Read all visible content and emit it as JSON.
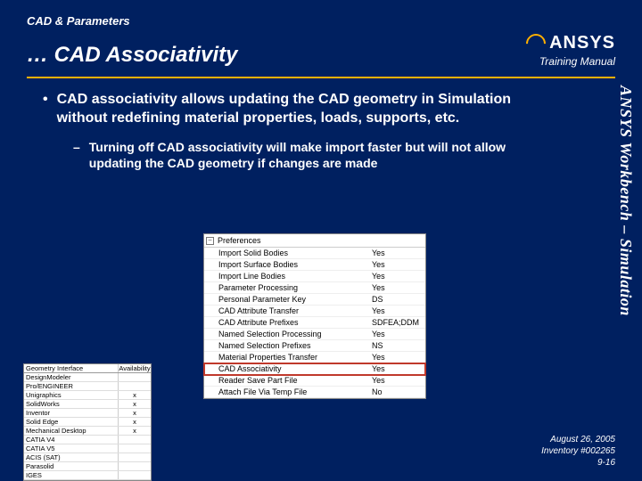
{
  "header": {
    "section_label": "CAD & Parameters",
    "title": "… CAD Associativity",
    "logo_text": "ANSYS",
    "training_manual": "Training Manual"
  },
  "sidebar_text": "ANSYS Workbench – Simulation",
  "bullets": {
    "main": "CAD associativity allows updating the CAD geometry in Simulation without redefining material properties, loads, supports, etc.",
    "sub": "Turning off CAD associativity will make import faster but will not allow updating the CAD geometry if changes are made"
  },
  "preferences": {
    "heading": "Preferences",
    "rows": [
      {
        "k": "Import Solid Bodies",
        "v": "Yes"
      },
      {
        "k": "Import Surface Bodies",
        "v": "Yes"
      },
      {
        "k": "Import Line Bodies",
        "v": "Yes"
      },
      {
        "k": "Parameter Processing",
        "v": "Yes"
      },
      {
        "k": "Personal Parameter Key",
        "v": "DS"
      },
      {
        "k": "CAD Attribute Transfer",
        "v": "Yes"
      },
      {
        "k": "CAD Attribute Prefixes",
        "v": "SDFEA;DDM"
      },
      {
        "k": "Named Selection Processing",
        "v": "Yes"
      },
      {
        "k": "Named Selection Prefixes",
        "v": "NS"
      },
      {
        "k": "Material Properties Transfer",
        "v": "Yes"
      },
      {
        "k": "CAD Associativity",
        "v": "Yes",
        "hl": true
      },
      {
        "k": "Reader Save Part File",
        "v": "Yes"
      },
      {
        "k": "Attach File Via Temp File",
        "v": "No"
      }
    ]
  },
  "availability": {
    "head": {
      "c1": "Geometry Interface",
      "c2": "Availability"
    },
    "rows": [
      {
        "c1": "DesignModeler",
        "c2": ""
      },
      {
        "c1": "Pro/ENGINEER",
        "c2": ""
      },
      {
        "c1": "Unigraphics",
        "c2": "x"
      },
      {
        "c1": "SolidWorks",
        "c2": "x"
      },
      {
        "c1": "Inventor",
        "c2": "x"
      },
      {
        "c1": "Solid Edge",
        "c2": "x"
      },
      {
        "c1": "Mechanical Desktop",
        "c2": "x"
      },
      {
        "c1": "CATIA V4",
        "c2": ""
      },
      {
        "c1": "CATIA V5",
        "c2": ""
      },
      {
        "c1": "ACIS (SAT)",
        "c2": ""
      },
      {
        "c1": "Parasolid",
        "c2": ""
      },
      {
        "c1": "IGES",
        "c2": ""
      }
    ]
  },
  "footer": {
    "date": "August 26, 2005",
    "inventory": "Inventory #002265",
    "page": "9-16"
  }
}
